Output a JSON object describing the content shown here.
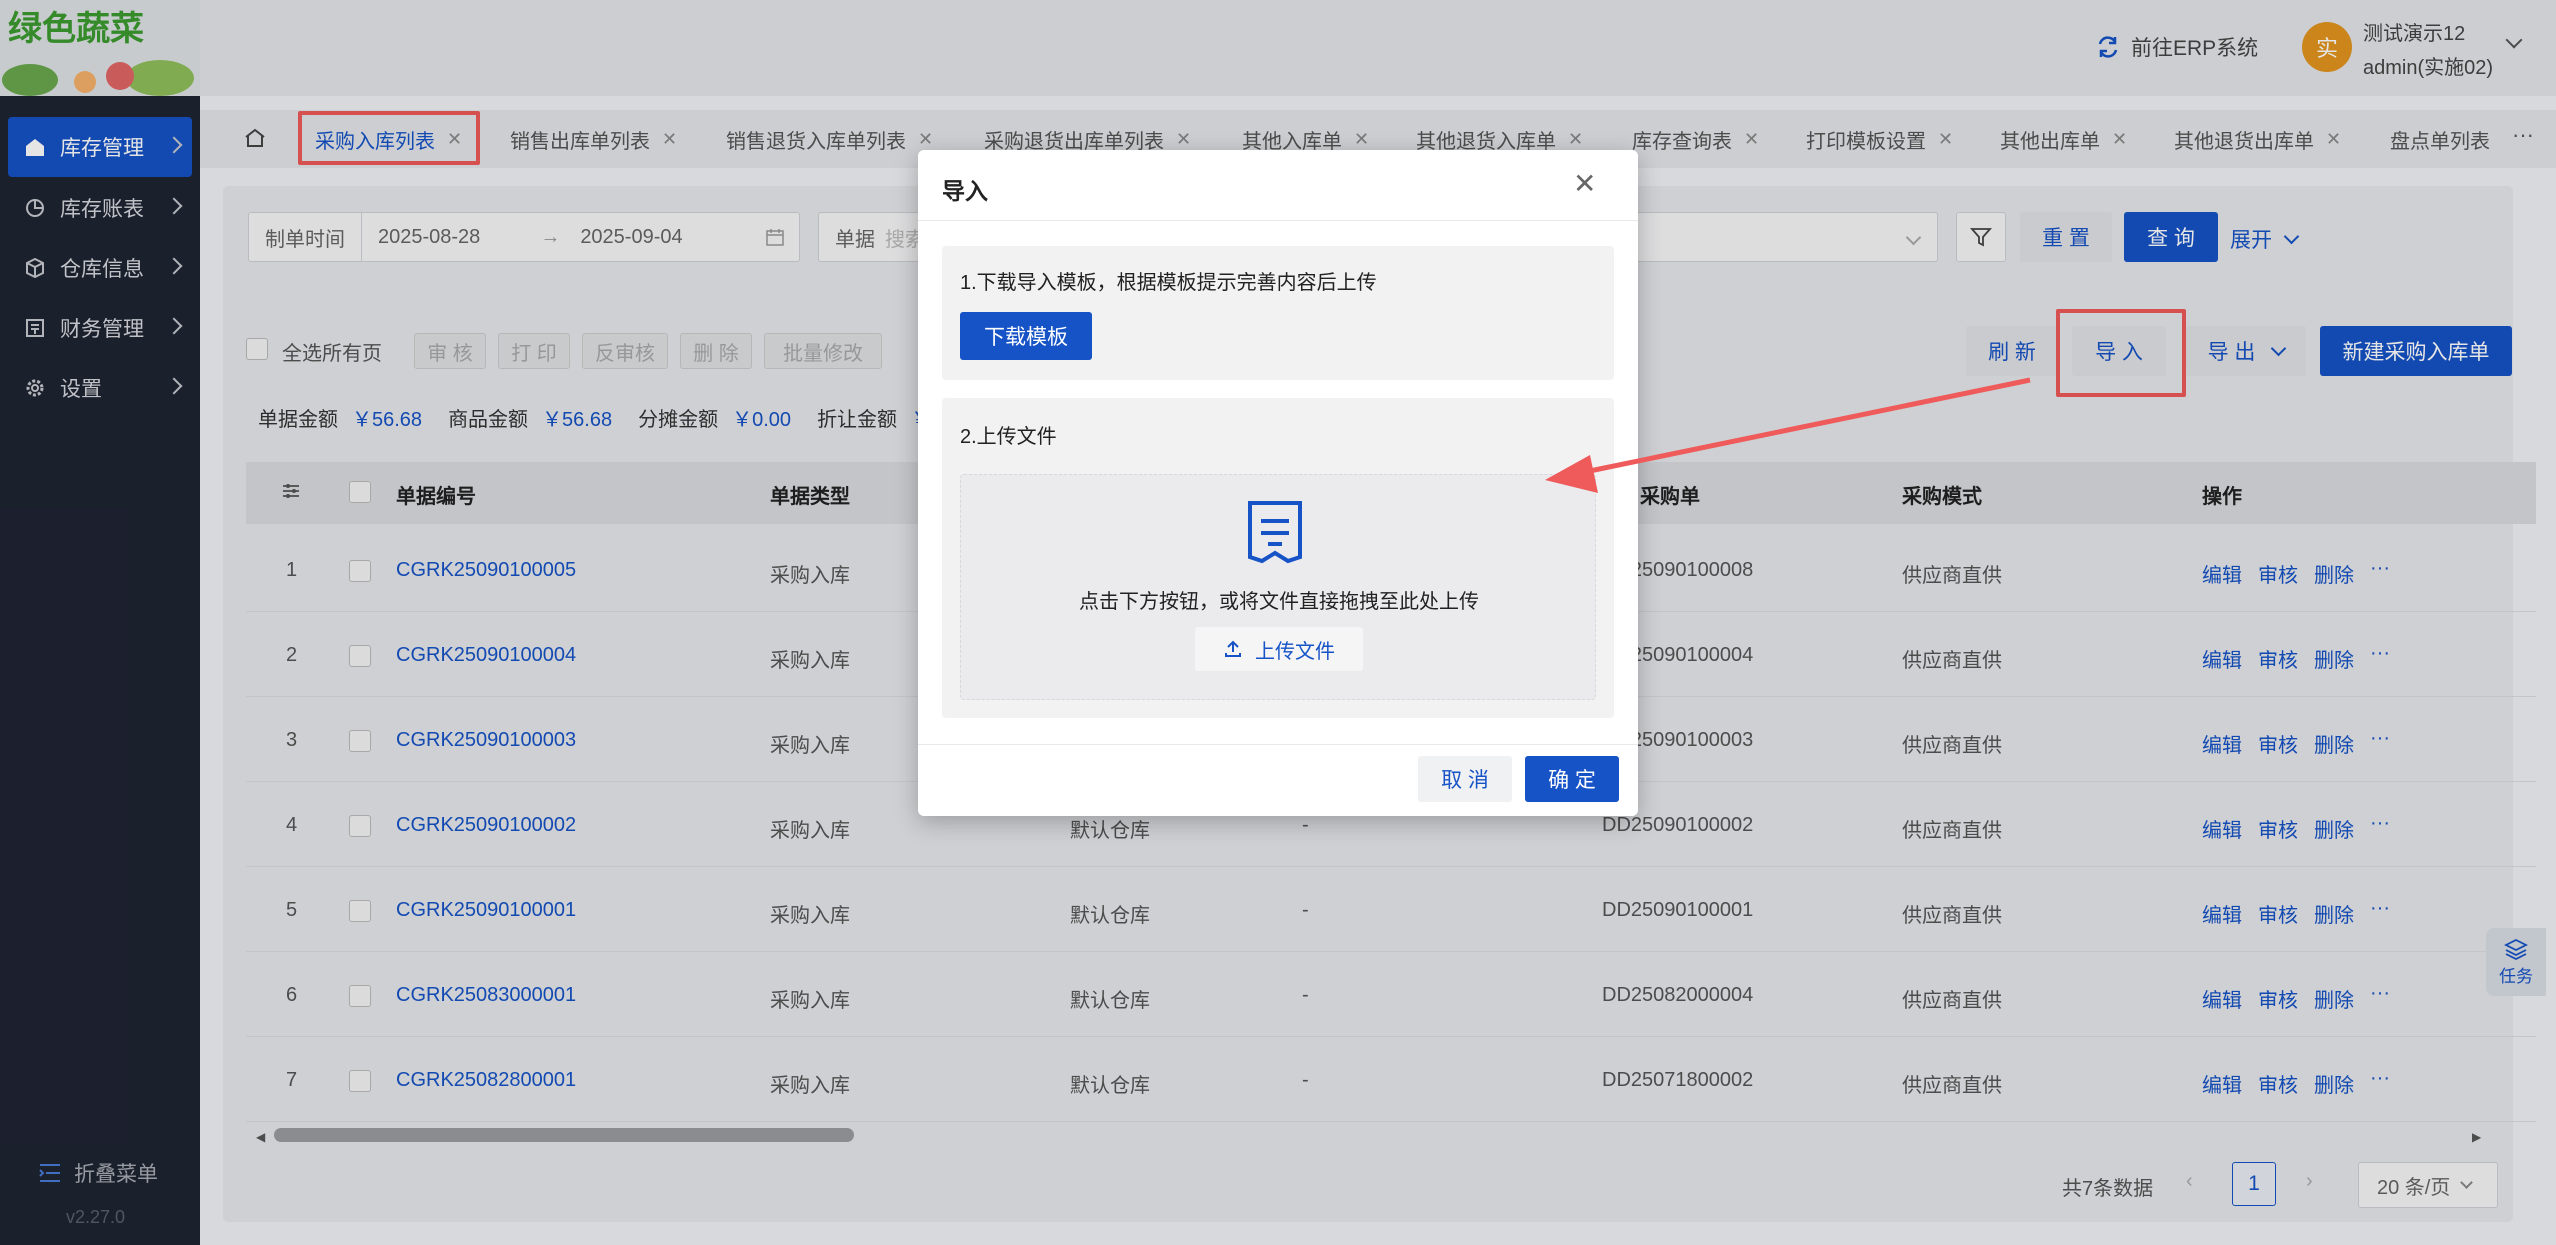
{
  "app": {
    "logo_text": "绿色蔬菜",
    "version": "v2.27.0"
  },
  "header": {
    "erp_link": "前往ERP系统",
    "user_avatar": "实",
    "user_name": "测试演示12",
    "user_account": "admin(实施02)"
  },
  "sidebar": {
    "items": [
      {
        "label": "库存管理",
        "active": true
      },
      {
        "label": "库存账表"
      },
      {
        "label": "仓库信息"
      },
      {
        "label": "财务管理"
      },
      {
        "label": "设置"
      }
    ],
    "collapse_label": "折叠菜单"
  },
  "tabs": [
    "采购入库列表",
    "销售出库单列表",
    "销售退货入库单列表",
    "采购退货出库单列表",
    "其他入库单",
    "其他退货入库单",
    "库存查询表",
    "打印模板设置",
    "其他出库单",
    "其他退货出库单",
    "盘点单列表"
  ],
  "filter": {
    "date_type": "制单时间",
    "date_start": "2025-08-28",
    "date_arrow": "→",
    "date_end": "2025-09-04",
    "doc_label": "单据",
    "doc_placeholder": "搜索",
    "reset": "重 置",
    "query": "查 询",
    "expand": "展开"
  },
  "toolbar": {
    "select_all": "全选所有页",
    "approve": "审 核",
    "print": "打 印",
    "unapprove": "反审核",
    "delete": "删 除",
    "batch_edit": "批量修改",
    "refresh": "刷 新",
    "import": "导 入",
    "export": "导 出",
    "new": "新建采购入库单"
  },
  "summary": [
    {
      "label": "单据金额",
      "value": "￥56.68"
    },
    {
      "label": "商品金额",
      "value": "￥56.68"
    },
    {
      "label": "分摊金额",
      "value": "￥0.00"
    },
    {
      "label": "折让金额",
      "value": "￥"
    }
  ],
  "table": {
    "headers": [
      "单据编号",
      "单据类型",
      "关联采购单",
      "采购模式",
      "操作"
    ],
    "rows": [
      {
        "no": "1",
        "code": "CGRK25090100005",
        "type": "采购入库",
        "wh": "",
        "dash": "",
        "po": "DD25090100008",
        "mode": "供应商直供"
      },
      {
        "no": "2",
        "code": "CGRK25090100004",
        "type": "采购入库",
        "wh": "",
        "dash": "",
        "po": "DD25090100004",
        "mode": "供应商直供"
      },
      {
        "no": "3",
        "code": "CGRK25090100003",
        "type": "采购入库",
        "wh": "",
        "dash": "",
        "po": "DD25090100003",
        "mode": "供应商直供"
      },
      {
        "no": "4",
        "code": "CGRK25090100002",
        "type": "采购入库",
        "wh": "默认仓库",
        "dash": "-",
        "po": "DD25090100002",
        "mode": "供应商直供"
      },
      {
        "no": "5",
        "code": "CGRK25090100001",
        "type": "采购入库",
        "wh": "默认仓库",
        "dash": "-",
        "po": "DD25090100001",
        "mode": "供应商直供"
      },
      {
        "no": "6",
        "code": "CGRK25083000001",
        "type": "采购入库",
        "wh": "默认仓库",
        "dash": "-",
        "po": "DD25082000004",
        "mode": "供应商直供"
      },
      {
        "no": "7",
        "code": "CGRK25082800001",
        "type": "采购入库",
        "wh": "默认仓库",
        "dash": "-",
        "po": "DD25071800002",
        "mode": "供应商直供"
      }
    ],
    "actions": {
      "edit": "编辑",
      "approve": "审核",
      "delete": "删除",
      "more": "···"
    }
  },
  "pagination": {
    "total": "共7条数据",
    "page": "1",
    "page_size": "20 条/页"
  },
  "task_label": "任务",
  "modal": {
    "title": "导入",
    "step1": "1.下载导入模板，根据模板提示完善内容后上传",
    "download": "下载模板",
    "step2": "2.上传文件",
    "upload_hint": "点击下方按钮，或将文件直接拖拽至此处上传",
    "upload_btn": "上传文件",
    "cancel": "取 消",
    "confirm": "确 定"
  },
  "colors": {
    "primary": "#1653c7",
    "annotation": "#ef5a5a",
    "sidebar": "#1f2433"
  }
}
